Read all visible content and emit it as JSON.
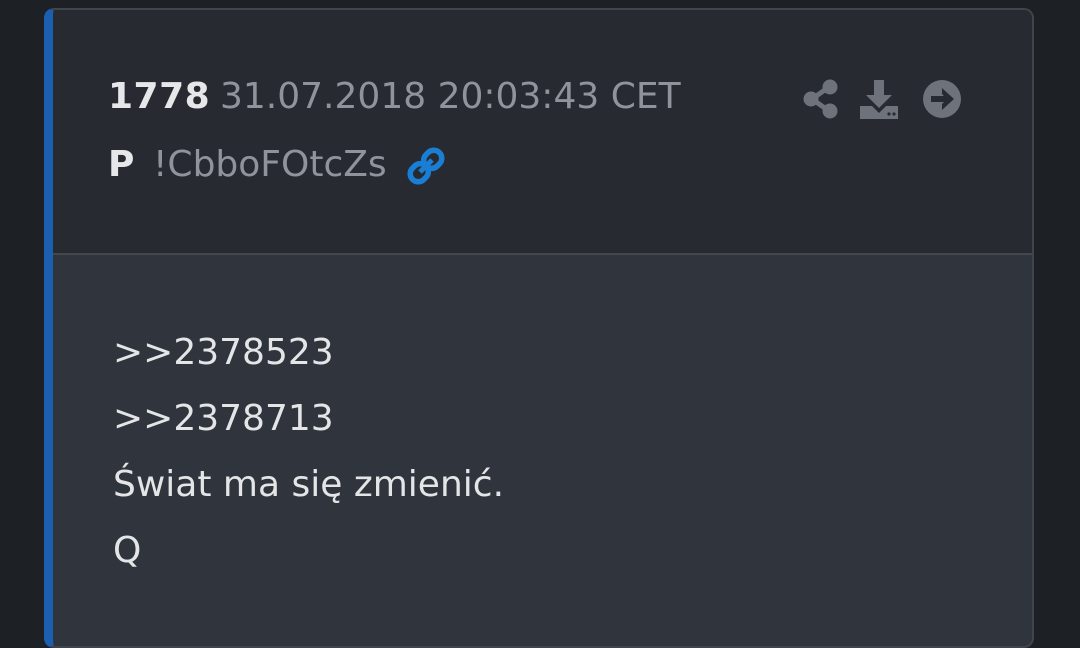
{
  "post": {
    "number": "1778",
    "timestamp": "31.07.2018 20:03:43 CET",
    "author": "P",
    "tripcode": "!CbboFOtcZs",
    "body_lines": [
      ">>2378523",
      ">>2378713",
      "Świat ma się zmienić.",
      "Q"
    ]
  },
  "icons": {
    "link": "link-icon",
    "share": "share-icon",
    "download": "download-icon",
    "go": "arrow-circle-right-icon"
  },
  "colors": {
    "accent_border": "#1c5fb0",
    "link_icon": "#1a7fd4",
    "muted_text": "#8f949c",
    "icon_gray": "#6e737b"
  }
}
